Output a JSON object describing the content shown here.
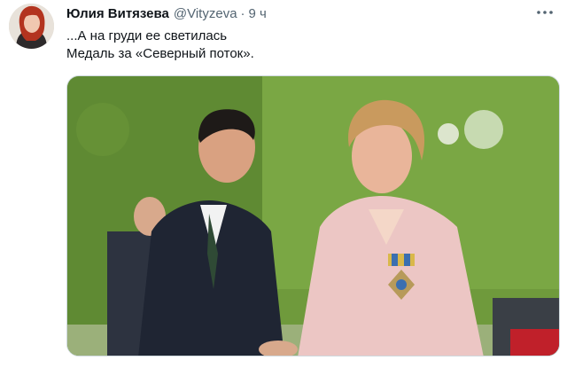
{
  "tweet": {
    "author_name": "Юлия Витязева",
    "author_handle": "@Vityzeva",
    "separator": "·",
    "time": "9 ч",
    "more_icon": "more-horizontal-icon",
    "text_line_1": "...А на груди ее светилась",
    "text_line_2": "Медаль за «Северный поток».",
    "media": {
      "kind": "photo",
      "content": "two people shaking hands in front of a green hedge"
    }
  },
  "colors": {
    "text_primary": "#0f1419",
    "text_secondary": "#536471",
    "border": "#cfd9de",
    "hedge": "#6f9a3c"
  }
}
